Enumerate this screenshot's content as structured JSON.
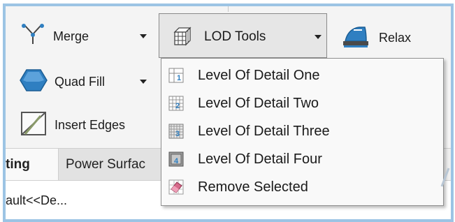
{
  "toolbar": {
    "merge_label": "Merge",
    "quad_fill_label": "Quad Fill",
    "insert_edges_label": "Insert Edges",
    "lod_tools_label": "LOD Tools",
    "relax_label": "Relax"
  },
  "lod_menu": {
    "items": [
      {
        "label": "Level Of Detail One",
        "icon": "lod-one-icon"
      },
      {
        "label": "Level Of Detail Two",
        "icon": "lod-two-icon"
      },
      {
        "label": "Level Of Detail Three",
        "icon": "lod-three-icon"
      },
      {
        "label": "Level Of Detail Four",
        "icon": "lod-four-icon"
      },
      {
        "label": "Remove Selected",
        "icon": "eraser-icon"
      }
    ]
  },
  "tabs": {
    "active_label": "ting",
    "power_label": "Power Surfac"
  },
  "status": {
    "text": "ault<<De..."
  },
  "colors": {
    "frame_border": "#9cc4e4",
    "accent_blue": "#2f7fc1",
    "toolbar_bg": "#f4f4f4"
  }
}
